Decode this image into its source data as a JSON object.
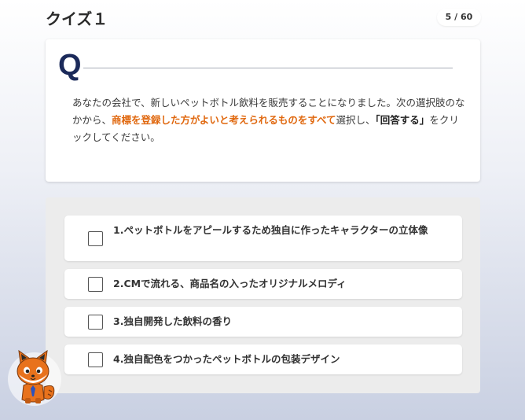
{
  "header": {
    "title": "クイズ１",
    "progress": "5 / 60"
  },
  "question": {
    "mark": "Q",
    "text_part1": "あなたの会社で、新しいペットボトル飲料を販売することになりました。次の選択肢のなかから、",
    "highlight": "商標を登録した方がよいと考えられるものをすべて",
    "text_part2": "選択し、",
    "emphasis": "「回答する」",
    "text_part3": "をクリックしてください。"
  },
  "options": [
    {
      "label": "1.ペットボトルをアピールするため独自に作ったキャラクターの立体像",
      "checked": false
    },
    {
      "label": "2.CMで流れる、商品名の入ったオリジナルメロディ",
      "checked": false
    },
    {
      "label": "3.独自開発した飲料の香り",
      "checked": false
    },
    {
      "label": "4.独自配色をつかったペットボトルの包装デザイン",
      "checked": false
    }
  ],
  "colors": {
    "accent_orange": "#e0680f",
    "q_navy": "#1b2a5a"
  },
  "mascot": {
    "icon": "fox-mascot-icon"
  }
}
